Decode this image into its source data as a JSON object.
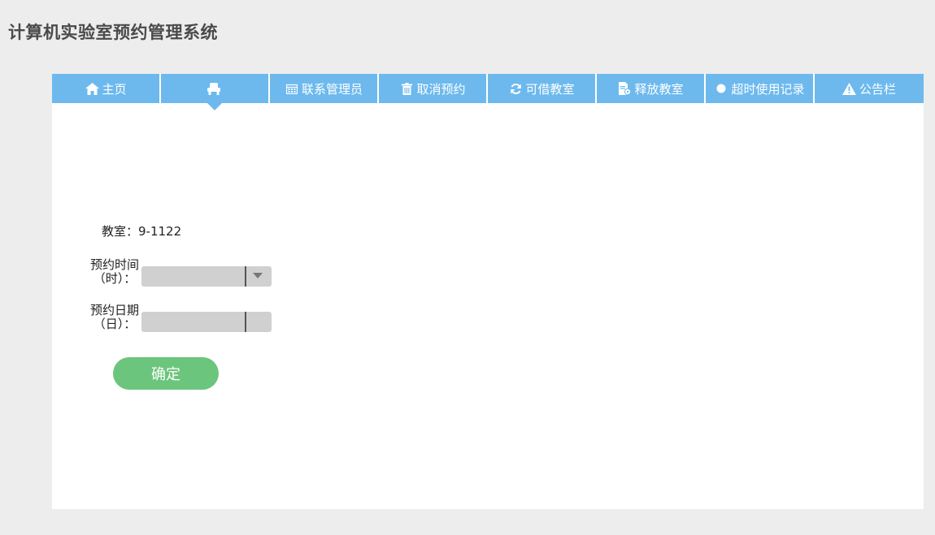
{
  "app": {
    "title": "计算机实验室预约管理系统"
  },
  "nav": {
    "items": [
      {
        "label": "主页",
        "icon": "home-icon"
      },
      {
        "label": "",
        "icon": "seat-icon",
        "active": true
      },
      {
        "label": "联系管理员",
        "icon": "calendar-icon"
      },
      {
        "label": "取消预约",
        "icon": "trash-icon"
      },
      {
        "label": "可借教室",
        "icon": "refresh-icon"
      },
      {
        "label": "释放教室",
        "icon": "document-gear-icon"
      },
      {
        "label": "超时使用记录",
        "icon": "circle-icon"
      },
      {
        "label": "公告栏",
        "icon": "warning-icon"
      }
    ]
  },
  "form": {
    "room_label": "教室：",
    "room_value": "9-1122",
    "time_label_line1": "预约时间",
    "time_label_line2": "（时）：",
    "time_value": "",
    "date_label_line1": "预约日期",
    "date_label_line2": "（日）：",
    "date_value": "",
    "confirm_label": "确定"
  },
  "colors": {
    "nav_bg": "#6db9ee",
    "page_bg": "#ededee",
    "button_bg": "#6cc57d",
    "select_bg": "#d0d0d0"
  }
}
